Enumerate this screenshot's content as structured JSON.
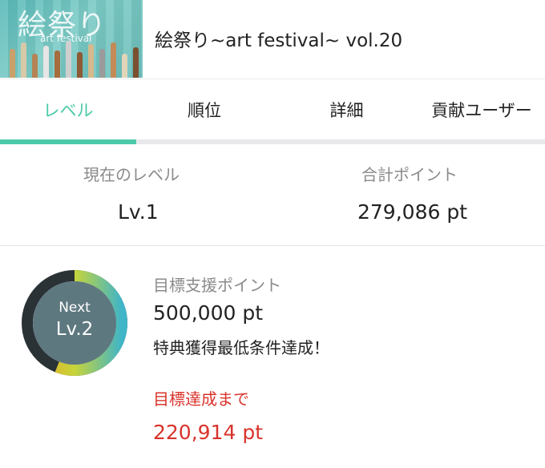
{
  "header": {
    "banner_title": "絵祭り",
    "banner_subtitle": "art festival",
    "title": "絵祭り~art festival~ vol.20"
  },
  "tabs": [
    {
      "label": "レベル",
      "active": true
    },
    {
      "label": "順位",
      "active": false
    },
    {
      "label": "詳細",
      "active": false
    },
    {
      "label": "貢献ユーザー",
      "active": false
    }
  ],
  "summary": {
    "current_level_label": "現在のレベル",
    "current_level_value": "Lv.1",
    "total_points_label": "合計ポイント",
    "total_points_value": "279,086 pt"
  },
  "next_level": {
    "caption": "Next",
    "level": "Lv.2"
  },
  "target": {
    "label": "目標支援ポイント",
    "value": "500,000 pt",
    "note": "特典獲得最低条件達成！",
    "remaining_label": "目標達成まで",
    "remaining_value": "220,914 pt",
    "progress_percent": 56
  },
  "colors": {
    "accent": "#4cc9a8",
    "alert": "#d9332b",
    "ring_center": "#5e7880",
    "ring_track": "#2b3236"
  }
}
